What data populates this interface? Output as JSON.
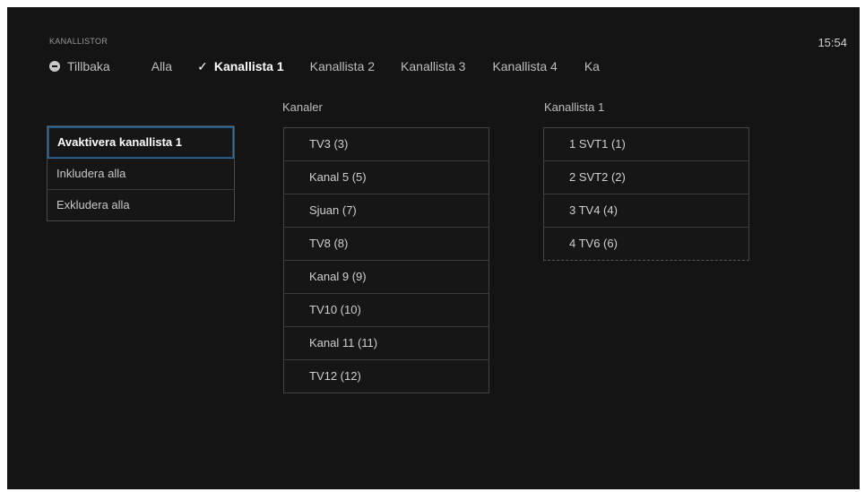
{
  "header": {
    "section_label": "KANALLISTOR",
    "clock": "15:54"
  },
  "nav": {
    "back_label": "Tillbaka",
    "tabs": [
      {
        "label": "Alla"
      },
      {
        "label": "Kanallista 1",
        "selected": true
      },
      {
        "label": "Kanallista 2"
      },
      {
        "label": "Kanallista 3"
      },
      {
        "label": "Kanallista 4"
      },
      {
        "label": "Ka"
      }
    ],
    "icons": {
      "back": "back-circle-icon",
      "selected": "checkmark-icon"
    }
  },
  "actions": [
    {
      "label": "Avaktivera kanallista 1",
      "focused": true
    },
    {
      "label": "Inkludera alla"
    },
    {
      "label": "Exkludera alla"
    }
  ],
  "channels": {
    "title": "Kanaler",
    "items": [
      "TV3 (3)",
      "Kanal 5 (5)",
      "Sjuan (7)",
      "TV8 (8)",
      "Kanal 9 (9)",
      "TV10 (10)",
      "Kanal 11 (11)",
      "TV12 (12)"
    ]
  },
  "channel_list": {
    "title": "Kanallista 1",
    "items": [
      "1 SVT1 (1)",
      "2 SVT2 (2)",
      "3 TV4 (4)",
      "4 TV6 (6)"
    ]
  },
  "colors": {
    "background": "#141414",
    "focus_border": "#2f6ea0"
  }
}
